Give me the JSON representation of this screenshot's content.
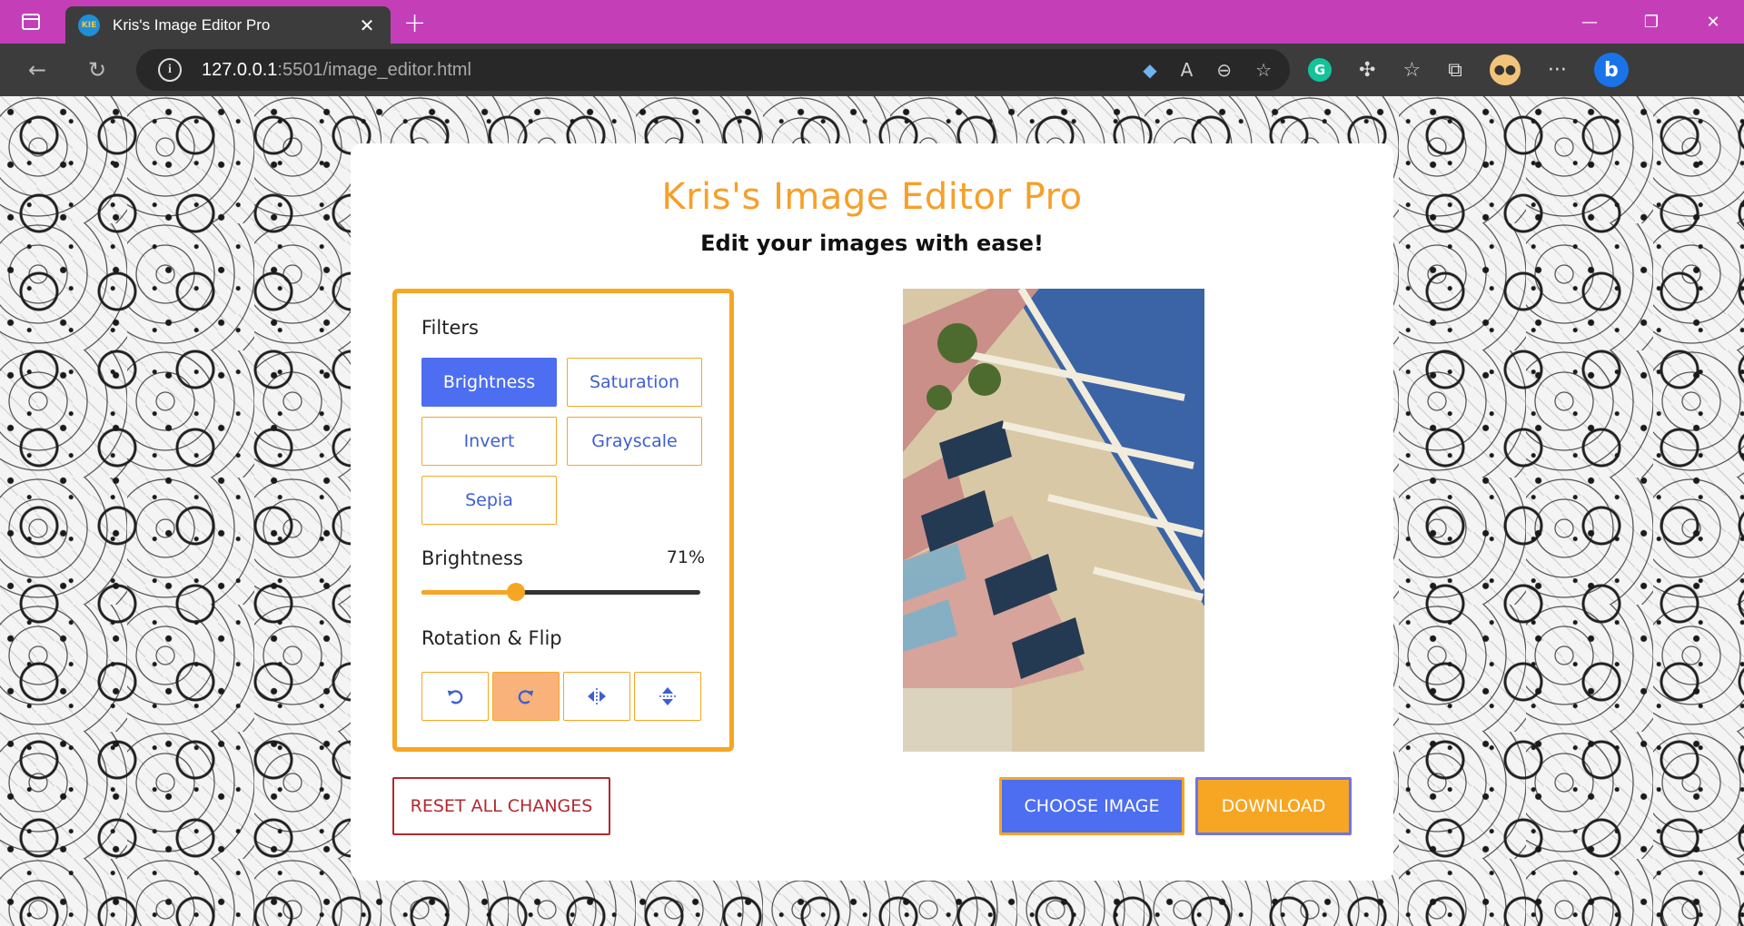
{
  "browser": {
    "tab_title": "Kris's Image Editor Pro",
    "favicon_text": "KIE",
    "url_host": "127.0.0.1",
    "url_rest": ":5501/image_editor.html",
    "avatar_icon": "cat-avatar-icon"
  },
  "app": {
    "title": "Kris's Image Editor Pro",
    "subtitle": "Edit your images with ease!"
  },
  "filters": {
    "label": "Filters",
    "options": [
      "Brightness",
      "Saturation",
      "Invert",
      "Grayscale",
      "Sepia"
    ],
    "active": "Brightness"
  },
  "slider": {
    "name": "Brightness",
    "value_text": "71%",
    "fraction": 0.34
  },
  "rotation": {
    "label": "Rotation & Flip",
    "buttons": [
      "rotate-left-icon",
      "rotate-right-icon",
      "flip-horizontal-icon",
      "flip-vertical-icon"
    ],
    "active_index": 1
  },
  "actions": {
    "reset": "RESET ALL CHANGES",
    "choose": "CHOOSE IMAGE",
    "download": "DOWNLOAD"
  },
  "colors": {
    "accent_orange": "#f6a623",
    "accent_blue": "#4d6ef0",
    "title_orange": "#f5a02a",
    "reset_red": "#b22830",
    "browser_magenta": "#c43fb7"
  }
}
